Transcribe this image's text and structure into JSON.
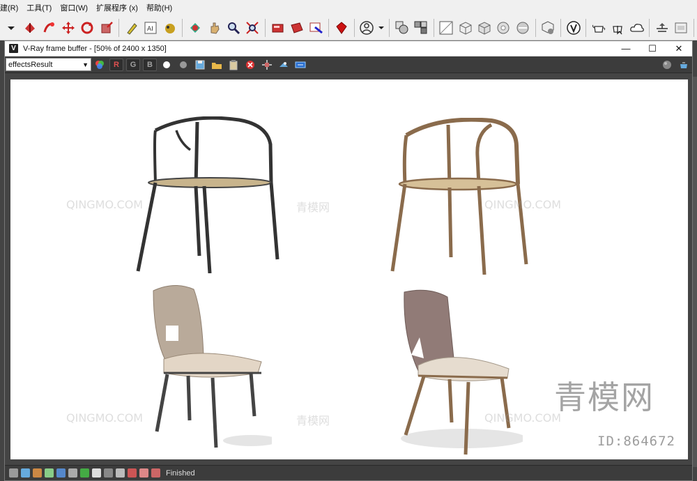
{
  "menu": [
    "建(R)",
    "工具(T)",
    "窗口(W)",
    "扩展程序 (x)",
    "帮助(H)"
  ],
  "toolbar_icons": [
    "dropdown-arrow",
    "select-object-icon",
    "link-icon",
    "move-icon",
    "rotate-icon",
    "scale-icon",
    "snap-icon",
    "text-icon",
    "paint-icon",
    "teapot-icon",
    "hand-icon",
    "zoom-icon",
    "zoom-extents-icon",
    "render-setup-icon",
    "render-frame-icon",
    "render-icon",
    "material-icon",
    "user-icon",
    "layer-icon",
    "group-icon",
    "grid-icon",
    "cube-icon",
    "cube2-icon",
    "sphere-icon",
    "sphere2-icon",
    "container-icon",
    "v-icon",
    "teapot2-icon",
    "cursor-icon",
    "cloud-icon",
    "shelf-icon",
    "slate-icon"
  ],
  "vfb": {
    "title": "V-Ray frame buffer - [50% of 2400 x 1350]",
    "channel": "effectsResult",
    "btn_r": "R",
    "btn_g": "G",
    "btn_b": "B",
    "status": "Finished"
  },
  "watermarks": {
    "site": "QINGMO.COM",
    "cn": "青模网",
    "big": "青模网",
    "id": "ID:864672"
  },
  "colors": {
    "canvas_bg": "#ffffff",
    "vfb_bg": "#3c3c3c"
  }
}
